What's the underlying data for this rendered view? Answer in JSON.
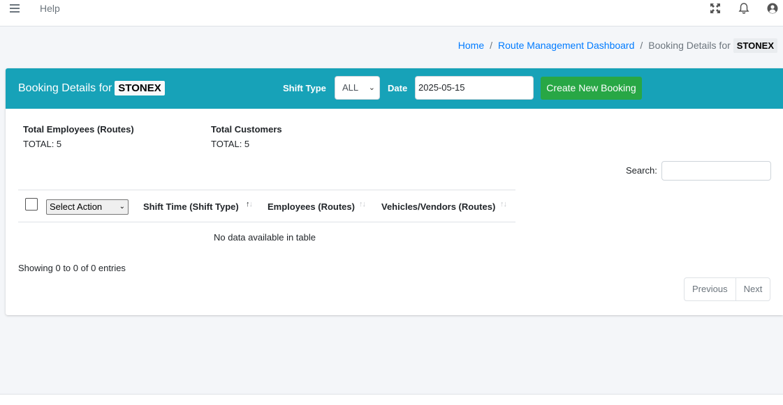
{
  "navbar": {
    "help_label": "Help",
    "icons": [
      "menu-icon",
      "fullscreen-icon",
      "bell-icon",
      "user-icon"
    ]
  },
  "breadcrumb": {
    "home": "Home",
    "dashboard": "Route Management Dashboard",
    "current": "Booking Details for",
    "company": "STONEX"
  },
  "card": {
    "title": "Booking Details for",
    "company": "STONEX",
    "shift_type_label": "Shift Type",
    "shift_type_value": "ALL",
    "date_label": "Date",
    "date_value": "2025-05-15",
    "create_button": "Create New Booking"
  },
  "stats": {
    "employees_title": "Total Employees (Routes)",
    "employees_value": "TOTAL: 5",
    "customers_title": "Total Customers",
    "customers_value": "TOTAL: 5"
  },
  "search": {
    "label": "Search:",
    "value": ""
  },
  "table": {
    "action_select": "Select Action",
    "columns": [
      "Shift Time (Shift Type)",
      "Employees (Routes)",
      "Vehicles/Vendors (Routes)"
    ],
    "empty_message": "No data available in table"
  },
  "pagination": {
    "info": "Showing 0 to 0 of 0 entries",
    "previous": "Previous",
    "next": "Next"
  },
  "colors": {
    "header_bg": "#17a2b8",
    "create_button": "#28a745",
    "link": "#007bff"
  }
}
